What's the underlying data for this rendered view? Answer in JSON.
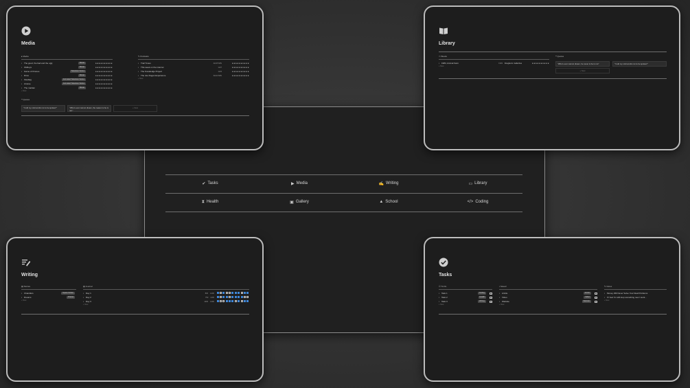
{
  "nav": {
    "row1": [
      {
        "icon": "check-circle-icon",
        "glyph": "✔",
        "label": "Tasks"
      },
      {
        "icon": "play-circle-icon",
        "glyph": "▶",
        "label": "Media"
      },
      {
        "icon": "writing-icon",
        "glyph": "✍",
        "label": "Writing"
      },
      {
        "icon": "book-icon",
        "glyph": "▭",
        "label": "Library"
      }
    ],
    "row2": [
      {
        "icon": "hourglass-icon",
        "glyph": "⧗",
        "label": "Health"
      },
      {
        "icon": "gallery-icon",
        "glyph": "▣",
        "label": "Gallery"
      },
      {
        "icon": "graduation-cap-icon",
        "glyph": "▲",
        "label": "School"
      },
      {
        "icon": "code-icon",
        "glyph": "</>",
        "label": "Coding"
      }
    ]
  },
  "media": {
    "title": "Media",
    "media_section": "Media",
    "items": [
      {
        "name": "The good, the bad and the ugly",
        "tag": "Movie",
        "stars": "★★★★★★★★★★"
      },
      {
        "name": "Oldboys",
        "tag": "Movie",
        "stars": "★★★★★★★★★★"
      },
      {
        "name": "Game of thrones",
        "tag": "Television Series",
        "stars": "★★★★★★★★★★"
      },
      {
        "name": "Drive",
        "tag": "Movie",
        "stars": "★★★★★★★★★★"
      },
      {
        "name": "Fleabag",
        "tag": "Animated Television Series",
        "stars": "★★★★★★★★★★"
      },
      {
        "name": "Arcane",
        "tag": "Animated Television Series",
        "stars": "★★★★★★★★★★"
      },
      {
        "name": "The martian",
        "tag": "Movie",
        "stars": "★★★★★★★★★★"
      }
    ],
    "podcasts_section": "Podcasts",
    "podcasts": [
      {
        "name": "Trail Tunes",
        "meta": "4H/15 MIN",
        "stars": "★★★★★★★★★★"
      },
      {
        "name": "This week on the internet",
        "meta": "1H/7",
        "stars": "★★★★★★★★★★"
      },
      {
        "name": "The Knowledge Project",
        "meta": "1H/3",
        "stars": "★★★★★★★★★★"
      },
      {
        "name": "The Joe Rogan Experience",
        "meta": "3H/13 MIN",
        "stars": "★★★★★★★★★★"
      }
    ],
    "new_label": "+ New",
    "quotes_section": "Quotes",
    "quotes": [
      "\"I told my cold words not to be spoken!\"",
      "\"Who's ever cannot dream, the reason is he is not.\""
    ]
  },
  "library": {
    "title": "Library",
    "books_section": "Books",
    "books": [
      {
        "name": "1984, Animal Farm",
        "meta": "1949",
        "author": "Douglas E. Gallenbas",
        "stars": "★★★★★★★★★★"
      }
    ],
    "quotes_section": "Quotes",
    "quotes": [
      "\"Who's ever cannot dream, he never is he is not\"",
      "\"I told my cold words not to be spoken!\""
    ],
    "new_label": "+ New"
  },
  "writing": {
    "title": "Writing",
    "stories_section": "Stories",
    "stories": [
      {
        "name": "Chandlers",
        "tag": "Space Fiction"
      },
      {
        "name": "Dreams",
        "tag": "Drama"
      }
    ],
    "journal_section": "Journal",
    "journal": [
      {
        "name": "Day 1",
        "a": "800",
        "b": "1200",
        "checks": [
          1,
          0,
          1,
          0,
          0,
          1,
          1,
          1,
          0,
          1,
          1
        ]
      },
      {
        "name": "Day 2",
        "a": "750",
        "b": "1100",
        "checks": [
          1,
          0,
          1,
          1,
          0,
          1,
          1,
          1,
          1,
          0,
          0
        ]
      },
      {
        "name": "Day 3",
        "a": "1000",
        "b": "1300",
        "checks": [
          1,
          0,
          0,
          1,
          1,
          1,
          0,
          1,
          0,
          1,
          1
        ]
      }
    ],
    "new_label": "+ New"
  },
  "tasks": {
    "title": "Tasks",
    "todo_section": "To Do",
    "todo": [
      {
        "name": "Task 1",
        "tag": "Coding"
      },
      {
        "name": "Task 2",
        "tag": "Health"
      },
      {
        "name": "Task 3",
        "tag": "Writing"
      }
    ],
    "saved_section": "Saved",
    "saved": [
      {
        "name": "Article",
        "tag": "Article"
      },
      {
        "name": "Video",
        "tag": "Video"
      },
      {
        "name": "Website",
        "tag": "Website"
      }
    ],
    "notes_section": "Notes",
    "notes": [
      "Money Will Never Solve Your Real Problems",
      "If I feel I'm still stop something new I work..."
    ],
    "new_label": "+ New"
  }
}
